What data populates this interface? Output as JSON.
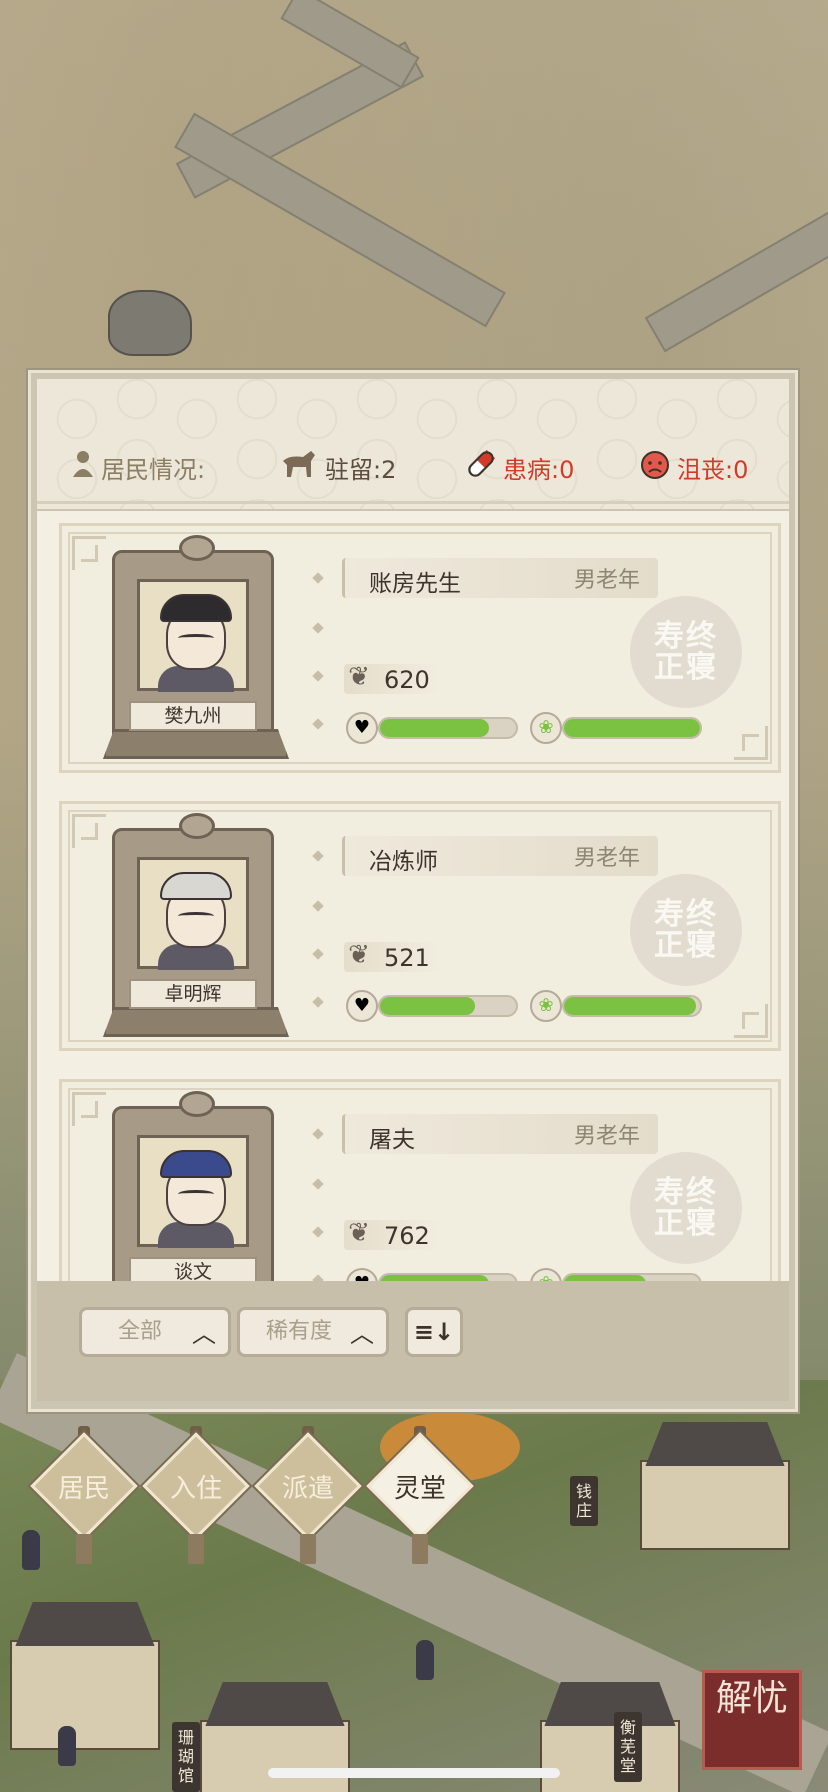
{
  "status": {
    "label": "居民情况:",
    "stay": "驻留:2",
    "sick": "患病:0",
    "sad": "沮丧:0",
    "colors": {
      "label": "#8c7e63",
      "sick": "#d43a2a",
      "sad": "#d43a2a"
    }
  },
  "residents": [
    {
      "name": "樊九州",
      "job": "账房先生",
      "tag": "男老年",
      "heart_value": "620",
      "health_level": 0.8,
      "mood_level": 1.0,
      "seal_text": "寿终正寝",
      "hat_color": "#2e2b2f"
    },
    {
      "name": "卓明辉",
      "job": "冶炼师",
      "tag": "男老年",
      "heart_value": "521",
      "health_level": 0.7,
      "mood_level": 0.97,
      "seal_text": "寿终正寝",
      "hat_color": "#d9d7d2"
    },
    {
      "name": "谈文",
      "job": "屠夫",
      "tag": "男老年",
      "heart_value": "762",
      "health_level": 0.8,
      "mood_level": 0.6,
      "seal_text": "寿终正寝",
      "hat_color": "#3a4a8c"
    }
  ],
  "filters": {
    "all": "全部",
    "rarity": "稀有度",
    "sort_glyph": "≡↓"
  },
  "tabs": [
    {
      "label": "居民",
      "active": false
    },
    {
      "label": "入住",
      "active": false
    },
    {
      "label": "派遣",
      "active": false
    },
    {
      "label": "灵堂",
      "active": true
    }
  ],
  "map_signs": {
    "qianzhuang": "钱庄",
    "shanhuguan": "珊瑚馆",
    "hengwutang": "衡芜堂"
  },
  "jieyou": "解忧",
  "accent": "#7cc242"
}
